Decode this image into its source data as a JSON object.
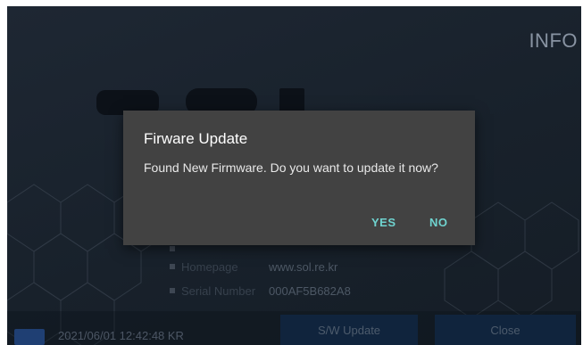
{
  "header": {
    "title": "INFO"
  },
  "logo": {
    "text": "SOL"
  },
  "info": {
    "rows": [
      {
        "label": "",
        "value": ""
      },
      {
        "label": "Homepage",
        "value": "www.sol.re.kr"
      },
      {
        "label": "Serial Number",
        "value": "000AF5B682A8"
      }
    ]
  },
  "status": {
    "datetime": "2021/06/01 12:42:48 KR"
  },
  "footer": {
    "sw_update_label": "S/W Update",
    "close_label": "Close"
  },
  "dialog": {
    "title": "Firware Update",
    "message": "Found New Firmware. Do you want to update it now?",
    "yes_label": "YES",
    "no_label": "NO"
  },
  "colors": {
    "background": "#1b2430",
    "dialog_bg": "#424242",
    "accent": "#6fd3cf",
    "button_bg": "#10243d"
  }
}
